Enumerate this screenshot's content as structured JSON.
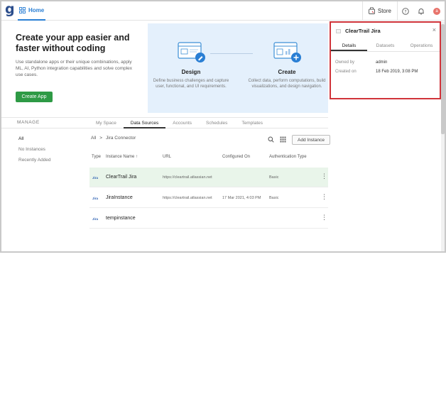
{
  "topbar": {
    "logo": "g",
    "home_label": "Home",
    "store_label": "Store",
    "avatar_initial": "a"
  },
  "hero": {
    "title": "Create your app easier and faster without coding",
    "description": "Use standalone apps or their unique combinations, apply ML, AI, Python integration capabilities and solve complex use cases.",
    "create_button": "Create App",
    "cards": [
      {
        "title": "Design",
        "text": "Define business challenges and capture user, functional, and UI requirements."
      },
      {
        "title": "Create",
        "text": "Collect data, perform computations, build visualizations, and design navigation."
      }
    ]
  },
  "nav": {
    "manage_label": "MANAGE",
    "tabs": [
      "My Space",
      "Data Sources",
      "Accounts",
      "Schedules",
      "Templates"
    ],
    "active_tab": "Data Sources"
  },
  "filters": [
    "All",
    "No Instances",
    "Recently Added"
  ],
  "breadcrumb": {
    "root": "All",
    "separator": ">",
    "current": "Jira Connector"
  },
  "toolbar": {
    "add_instance": "Add Instance"
  },
  "table": {
    "headers": {
      "type": "Type",
      "name": "Instance Name ↑",
      "url": "URL",
      "configured": "Configured On",
      "auth": "Authentication Type"
    },
    "rows": [
      {
        "type": "Jira",
        "name": "ClearTrail Jira",
        "url": "https://cleartrail.atlassian.net",
        "configured": "",
        "auth": "Basic",
        "selected": true
      },
      {
        "type": "Jira",
        "name": "JiraInstance",
        "url": "https://cleartrail.atlassian.net",
        "configured": "17 Mar 2021, 4:03 PM",
        "auth": "Basic",
        "selected": false
      },
      {
        "type": "Jira",
        "name": "tempinstance",
        "url": "",
        "configured": "",
        "auth": "",
        "selected": false
      }
    ]
  },
  "panel": {
    "title": "ClearTrail Jira",
    "tabs": [
      "Details",
      "Datasets",
      "Operations"
    ],
    "owned_label": "Owned by",
    "owned_value": "admin",
    "created_label": "Created on",
    "created_value": "18 Feb 2019, 3:08 PM"
  },
  "colors": {
    "accent": "#2a7fd4",
    "create_button": "#2e9a45",
    "selected_row": "#e9f5ea",
    "panel_border": "#d0343a",
    "promo_bg": "#e4f0fc"
  }
}
